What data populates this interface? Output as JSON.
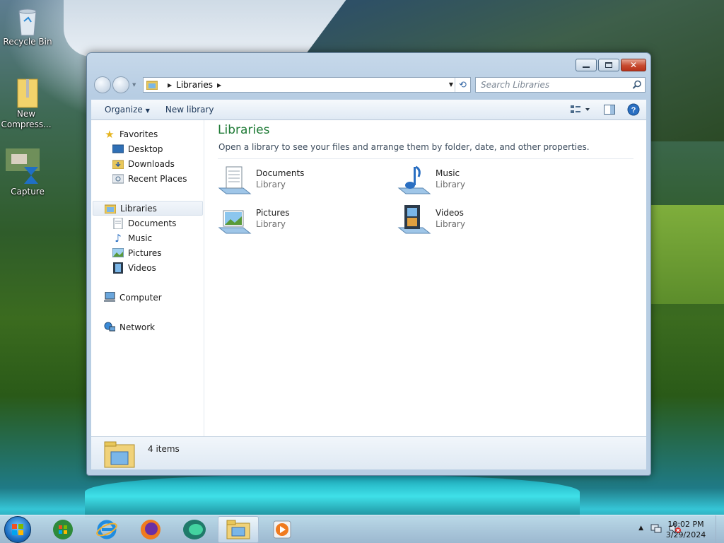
{
  "desktop": {
    "icons": [
      {
        "label": "Recycle Bin"
      },
      {
        "label": "New Compress..."
      },
      {
        "label": "Capture"
      }
    ]
  },
  "window": {
    "address": {
      "crumb": "Libraries"
    },
    "search": {
      "placeholder": "Search Libraries"
    },
    "toolbar": {
      "organize": "Organize",
      "new_library": "New library"
    },
    "nav": {
      "favorites": "Favorites",
      "desktop": "Desktop",
      "downloads": "Downloads",
      "recent_places": "Recent Places",
      "libraries": "Libraries",
      "documents": "Documents",
      "music": "Music",
      "pictures": "Pictures",
      "videos": "Videos",
      "computer": "Computer",
      "network": "Network"
    },
    "content": {
      "title": "Libraries",
      "subtitle": "Open a library to see your files and arrange them by folder, date, and other properties.",
      "libraries": [
        {
          "name": "Documents",
          "type": "Library",
          "icon": "documents-library-icon"
        },
        {
          "name": "Music",
          "type": "Library",
          "icon": "music-library-icon"
        },
        {
          "name": "Pictures",
          "type": "Library",
          "icon": "pictures-library-icon"
        },
        {
          "name": "Videos",
          "type": "Library",
          "icon": "videos-library-icon"
        }
      ]
    },
    "status": {
      "count": "4 items"
    }
  },
  "taskbar": {
    "apps": [
      "media-center-icon",
      "internet-explorer-icon",
      "firefox-icon",
      "edge-icon",
      "windows-explorer-icon",
      "media-player-icon"
    ],
    "clock": {
      "time": "10:02 PM",
      "date": "3/29/2024"
    }
  },
  "colors": {
    "title_green": "#1e7a35",
    "toolbar_text": "#1e395b"
  }
}
